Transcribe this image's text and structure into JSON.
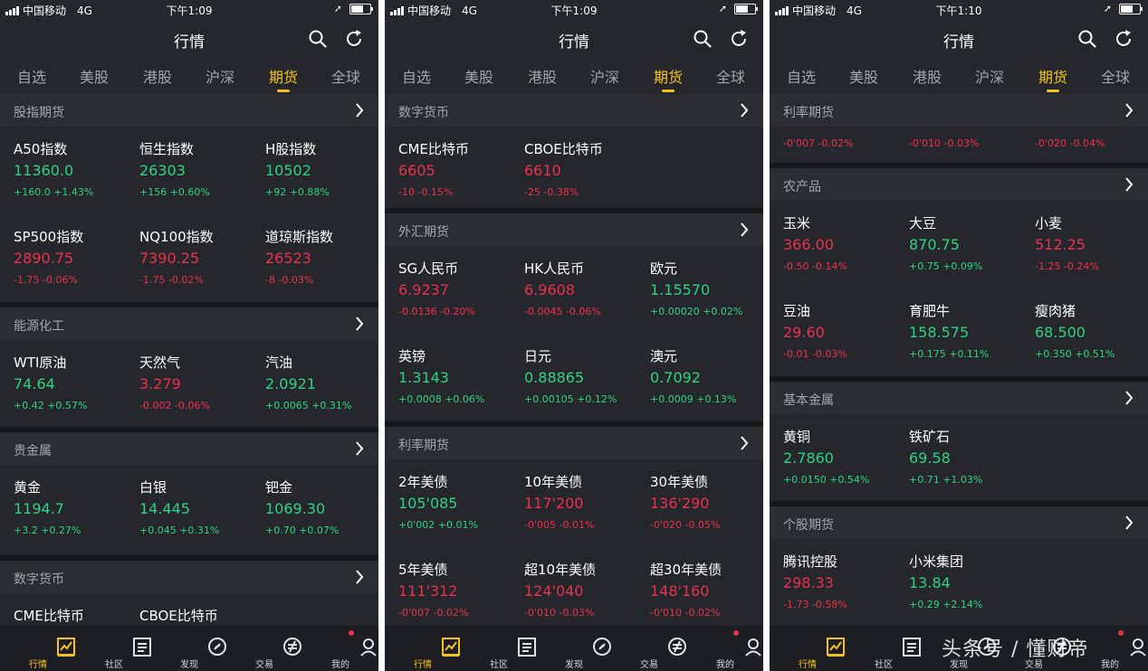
{
  "phones": [
    {
      "status": {
        "carrier": "中国移动",
        "network": "4G",
        "time": "下午1:09"
      },
      "title": "行情",
      "tabs": [
        "自选",
        "美股",
        "港股",
        "沪深",
        "期货",
        "全球"
      ],
      "active_tab": 4,
      "sections": [
        {
          "title": "股指期货",
          "items": [
            {
              "name": "A50指数",
              "price": "11360.0",
              "change": "+160.0 +1.43%",
              "dir": "up"
            },
            {
              "name": "恒生指数",
              "price": "26303",
              "change": "+156 +0.60%",
              "dir": "up"
            },
            {
              "name": "H股指数",
              "price": "10502",
              "change": "+92 +0.88%",
              "dir": "up"
            },
            {
              "name": "SP500指数",
              "price": "2890.75",
              "change": "-1.75 -0.06%",
              "dir": "down"
            },
            {
              "name": "NQ100指数",
              "price": "7390.25",
              "change": "-1.75 -0.02%",
              "dir": "down"
            },
            {
              "name": "道琼斯指数",
              "price": "26523",
              "change": "-8 -0.03%",
              "dir": "down"
            }
          ]
        },
        {
          "title": "能源化工",
          "items": [
            {
              "name": "WTI原油",
              "price": "74.64",
              "change": "+0.42 +0.57%",
              "dir": "up"
            },
            {
              "name": "天然气",
              "price": "3.279",
              "change": "-0.002 -0.06%",
              "dir": "down"
            },
            {
              "name": "汽油",
              "price": "2.0921",
              "change": "+0.0065 +0.31%",
              "dir": "up"
            }
          ]
        },
        {
          "title": "贵金属",
          "items": [
            {
              "name": "黄金",
              "price": "1194.7",
              "change": "+3.2 +0.27%",
              "dir": "up"
            },
            {
              "name": "白银",
              "price": "14.445",
              "change": "+0.045 +0.31%",
              "dir": "up"
            },
            {
              "name": "钯金",
              "price": "1069.30",
              "change": "+0.70 +0.07%",
              "dir": "up"
            }
          ]
        },
        {
          "title": "数字货币",
          "items": [
            {
              "name": "CME比特币",
              "price": "",
              "change": "",
              "dir": "up"
            },
            {
              "name": "CBOE比特币",
              "price": "",
              "change": "",
              "dir": "up"
            }
          ]
        }
      ],
      "bottom_tabs": [
        "行情",
        "社区",
        "发现",
        "交易",
        "我的"
      ]
    },
    {
      "status": {
        "carrier": "中国移动",
        "network": "4G",
        "time": "下午1:09"
      },
      "title": "行情",
      "tabs": [
        "自选",
        "美股",
        "港股",
        "沪深",
        "期货",
        "全球"
      ],
      "active_tab": 4,
      "sections": [
        {
          "title": "数字货币",
          "items": [
            {
              "name": "CME比特币",
              "price": "6605",
              "change": "-10 -0.15%",
              "dir": "down"
            },
            {
              "name": "CBOE比特币",
              "price": "6610",
              "change": "-25 -0.38%",
              "dir": "down"
            }
          ]
        },
        {
          "title": "外汇期货",
          "items": [
            {
              "name": "SG人民币",
              "price": "6.9237",
              "change": "-0.0136 -0.20%",
              "dir": "down"
            },
            {
              "name": "HK人民币",
              "price": "6.9608",
              "change": "-0.0045 -0.06%",
              "dir": "down"
            },
            {
              "name": "欧元",
              "price": "1.15570",
              "change": "+0.00020 +0.02%",
              "dir": "up"
            },
            {
              "name": "英镑",
              "price": "1.3143",
              "change": "+0.0008 +0.06%",
              "dir": "up"
            },
            {
              "name": "日元",
              "price": "0.88865",
              "change": "+0.00105 +0.12%",
              "dir": "up"
            },
            {
              "name": "澳元",
              "price": "0.7092",
              "change": "+0.0009 +0.13%",
              "dir": "up"
            }
          ]
        },
        {
          "title": "利率期货",
          "items": [
            {
              "name": "2年美债",
              "price": "105'085",
              "change": "+0'002 +0.01%",
              "dir": "up"
            },
            {
              "name": "10年美债",
              "price": "117'200",
              "change": "-0'005 -0.01%",
              "dir": "down"
            },
            {
              "name": "30年美债",
              "price": "136'290",
              "change": "-0'020 -0.05%",
              "dir": "down"
            },
            {
              "name": "5年美债",
              "price": "111'312",
              "change": "-0'007 -0.02%",
              "dir": "down"
            },
            {
              "name": "超10年美债",
              "price": "124'040",
              "change": "-0'010 -0.03%",
              "dir": "down"
            },
            {
              "name": "超30年美债",
              "price": "148'160",
              "change": "-0'010 -0.02%",
              "dir": "down"
            }
          ]
        }
      ],
      "bottom_tabs": [
        "行情",
        "社区",
        "发现",
        "交易",
        "我的"
      ]
    },
    {
      "status": {
        "carrier": "中国移动",
        "network": "4G",
        "time": "下午1:10"
      },
      "title": "行情",
      "tabs": [
        "自选",
        "美股",
        "港股",
        "沪深",
        "期货",
        "全球"
      ],
      "active_tab": 4,
      "sections": [
        {
          "title": "利率期货",
          "items": [
            {
              "name": "",
              "price": "",
              "change": "-0'007 -0.02%",
              "dir": "down"
            },
            {
              "name": "",
              "price": "",
              "change": "-0'010 -0.03%",
              "dir": "down"
            },
            {
              "name": "",
              "price": "",
              "change": "-0'020 -0.04%",
              "dir": "down"
            }
          ]
        },
        {
          "title": "农产品",
          "items": [
            {
              "name": "玉米",
              "price": "366.00",
              "change": "-0.50 -0.14%",
              "dir": "down"
            },
            {
              "name": "大豆",
              "price": "870.75",
              "change": "+0.75 +0.09%",
              "dir": "up"
            },
            {
              "name": "小麦",
              "price": "512.25",
              "change": "-1.25 -0.24%",
              "dir": "down"
            },
            {
              "name": "豆油",
              "price": "29.60",
              "change": "-0.01 -0.03%",
              "dir": "down"
            },
            {
              "name": "育肥牛",
              "price": "158.575",
              "change": "+0.175 +0.11%",
              "dir": "up"
            },
            {
              "name": "瘦肉猪",
              "price": "68.500",
              "change": "+0.350 +0.51%",
              "dir": "up"
            }
          ]
        },
        {
          "title": "基本金属",
          "items": [
            {
              "name": "黄铜",
              "price": "2.7860",
              "change": "+0.0150 +0.54%",
              "dir": "up"
            },
            {
              "name": "铁矿石",
              "price": "69.58",
              "change": "+0.71 +1.03%",
              "dir": "up"
            }
          ]
        },
        {
          "title": "个股期货",
          "items": [
            {
              "name": "腾讯控股",
              "price": "298.33",
              "change": "-1.73 -0.58%",
              "dir": "down"
            },
            {
              "name": "小米集团",
              "price": "13.84",
              "change": "+0.29 +2.14%",
              "dir": "up"
            }
          ]
        }
      ],
      "bottom_tabs": [
        "行情",
        "社区",
        "发现",
        "交易",
        "我的"
      ]
    }
  ],
  "watermark": "头条号 / 懂财帝",
  "colors": {
    "up": "#2ed182",
    "down": "#e8304a",
    "accent": "#f5c21b",
    "background": "#26272d"
  }
}
